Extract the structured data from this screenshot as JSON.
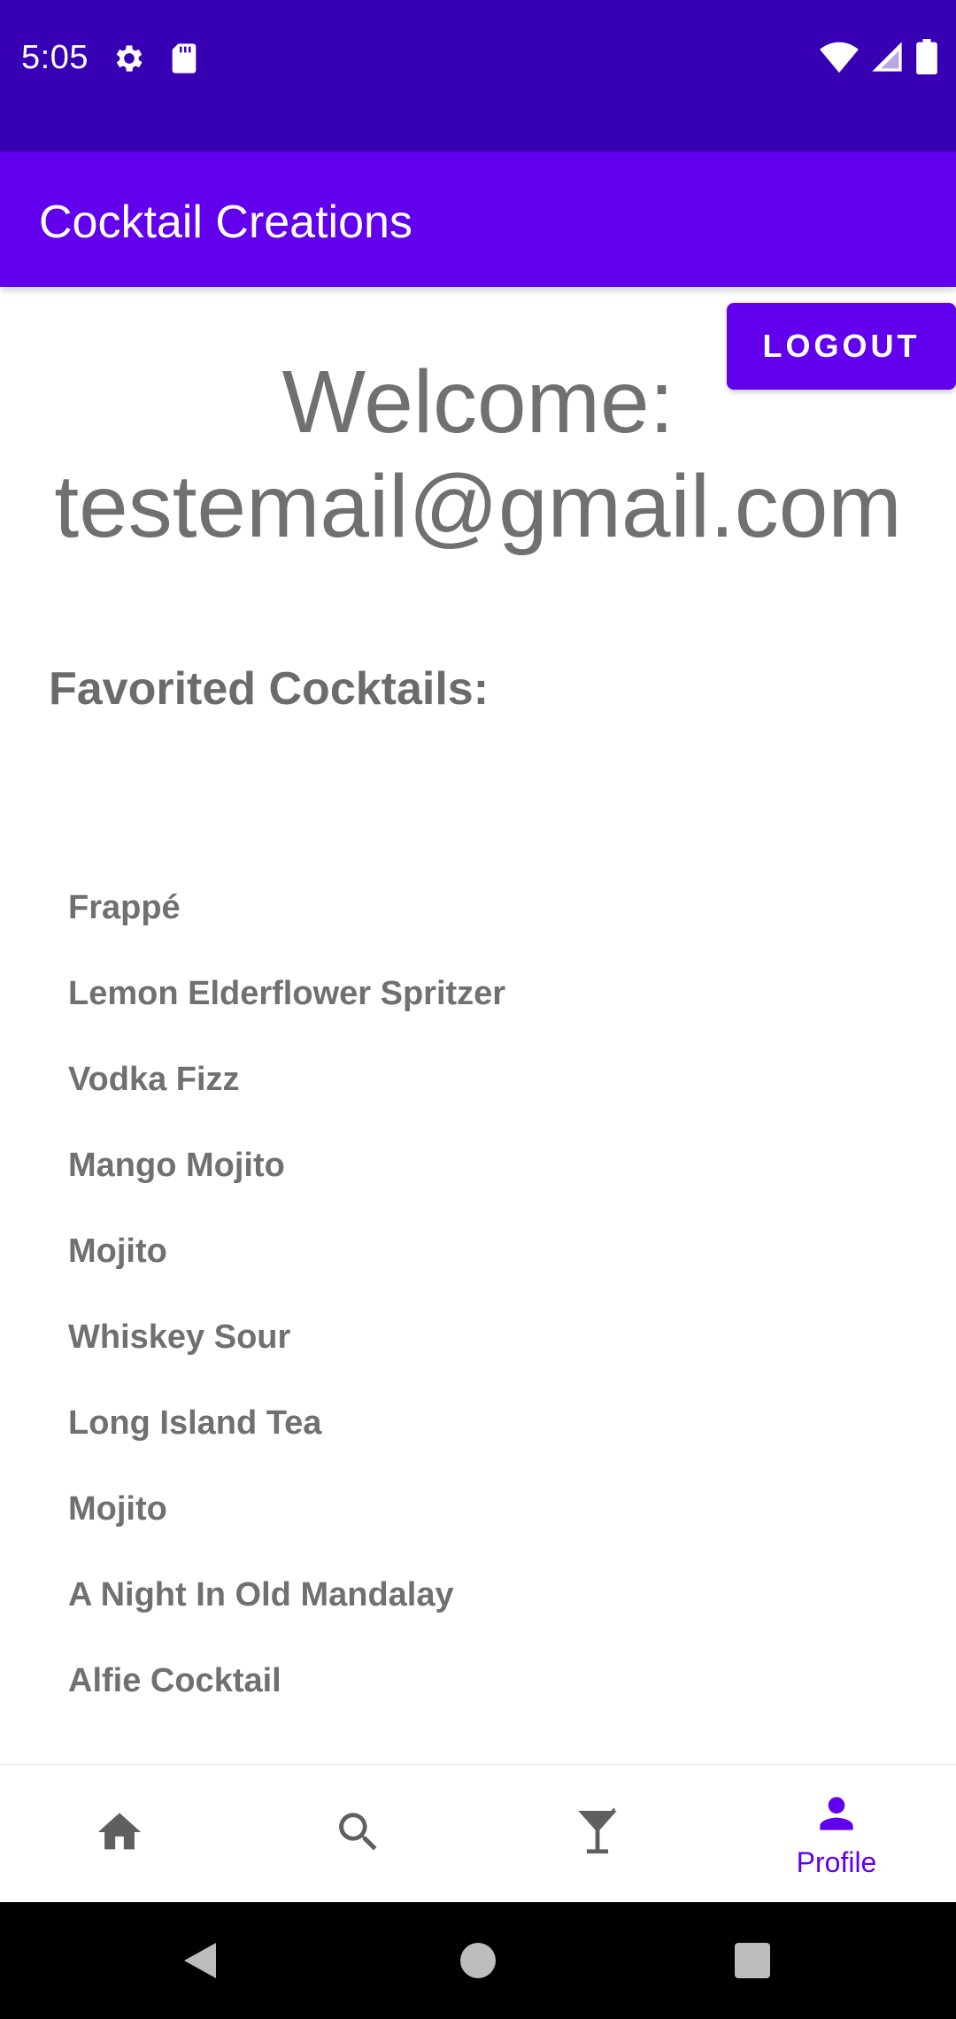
{
  "status_bar": {
    "time": "5:05",
    "icons": [
      "gear-icon",
      "sd-card-icon",
      "wifi-icon",
      "signal-icon",
      "battery-icon"
    ],
    "background": "#3700B3"
  },
  "app_bar": {
    "title": "Cocktail Creations",
    "background": "#6200EE"
  },
  "logout_label": "LOGOUT",
  "welcome": {
    "line1": "Welcome:",
    "line2": "testemail@gmail.com"
  },
  "favorites": {
    "heading": "Favorited Cocktails:",
    "items": [
      "Frappé",
      "Lemon Elderflower Spritzer",
      "Vodka Fizz",
      "Mango Mojito",
      "Mojito",
      "Whiskey Sour",
      "Long Island Tea",
      "Mojito",
      "A Night In Old Mandalay",
      "Alfie Cocktail"
    ]
  },
  "bottom_nav": {
    "items": [
      {
        "icon": "home-icon",
        "label": ""
      },
      {
        "icon": "search-icon",
        "label": ""
      },
      {
        "icon": "cocktail-glass-icon",
        "label": ""
      },
      {
        "icon": "person-icon",
        "label": "Profile",
        "selected": true
      }
    ],
    "active_color": "#6200EE",
    "inactive_color": "#5f5f5f"
  },
  "system_nav": {
    "icons": [
      "back-icon",
      "home-circle-icon",
      "recents-icon"
    ]
  }
}
